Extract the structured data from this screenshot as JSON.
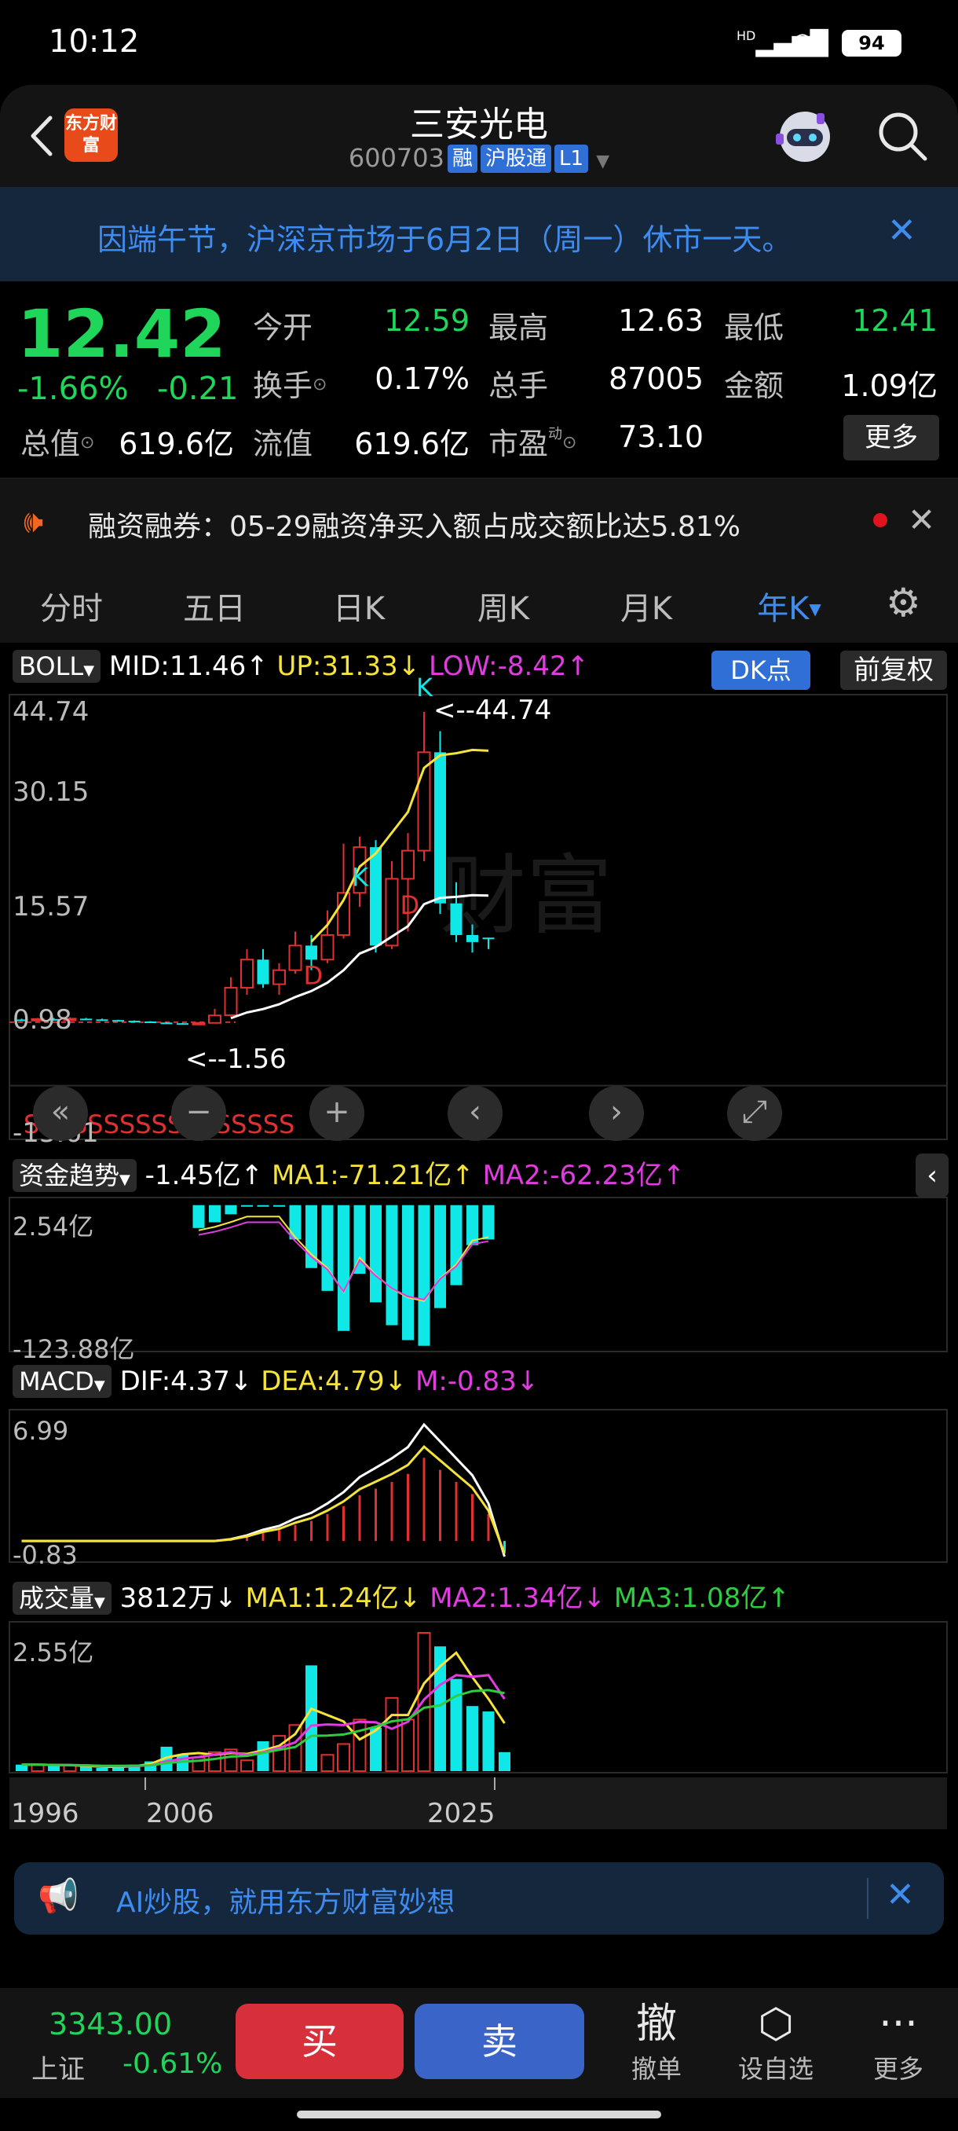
{
  "status_bar": {
    "time": "10:12",
    "signal_label": "HD",
    "battery": "94"
  },
  "header": {
    "logo_text": "东方财富",
    "stock_name": "三安光电",
    "stock_code": "600703",
    "tags": [
      "融",
      "沪股通",
      "L1"
    ]
  },
  "notice": {
    "text": "因端午节，沪深京市场于6月2日（周一）休市一天。"
  },
  "quote": {
    "price": "12.42",
    "change_pct": "-1.66%",
    "change_amt": "-0.21",
    "fields": [
      {
        "label": "今开",
        "value": "12.59",
        "color": "green"
      },
      {
        "label": "最高",
        "value": "12.63",
        "color": "white"
      },
      {
        "label": "最低",
        "value": "12.41",
        "color": "green"
      },
      {
        "label": "换手",
        "value": "0.17%",
        "color": "white"
      },
      {
        "label": "总手",
        "value": "87005",
        "color": "white"
      },
      {
        "label": "金额",
        "value": "1.09亿",
        "color": "white"
      },
      {
        "label": "总值",
        "value": "619.6亿",
        "color": "white"
      },
      {
        "label": "流值",
        "value": "619.6亿",
        "color": "white"
      },
      {
        "label": "市盈",
        "value": "73.10",
        "color": "white"
      }
    ],
    "pe_superscript": "动",
    "more_label": "更多"
  },
  "margin_banner": {
    "text": "融资融券：05-29融资净买入额占成交额比达5.81%"
  },
  "kline_tabs": {
    "items": [
      "分时",
      "五日",
      "日K",
      "周K",
      "月K",
      "年K"
    ],
    "active": "年K"
  },
  "indicators": {
    "boll": {
      "name": "BOLL",
      "mid": "MID:11.46",
      "up": "UP:31.33",
      "low": "LOW:-8.42"
    },
    "dk_label": "DK点",
    "fq_label": "前复权",
    "price_axis": [
      "44.74",
      "30.15",
      "15.57",
      "0.98",
      "-13.61"
    ],
    "high_marker": "<--44.74",
    "low_marker": "<--1.56",
    "fund": {
      "name": "资金趋势",
      "value": "-1.45亿",
      "ma1": "MA1:-71.21亿",
      "ma2": "MA2:-62.23亿",
      "axis_top": "2.54亿",
      "axis_bottom": "-123.88亿"
    },
    "macd": {
      "name": "MACD",
      "dif": "DIF:4.37",
      "dea": "DEA:4.79",
      "m": "M:-0.83",
      "axis_top": "6.99",
      "axis_bottom": "-0.83"
    },
    "volume": {
      "name": "成交量",
      "value": "3812万",
      "ma1": "MA1:1.24亿",
      "ma2": "MA2:1.34亿",
      "ma3": "MA3:1.08亿",
      "axis_top": "2.55亿"
    },
    "x_axis": [
      "1996",
      "2006",
      "2025"
    ]
  },
  "chart_data": {
    "type": "candlestick",
    "period": "年K",
    "price_range": [
      -13.61,
      44.74
    ],
    "candles": [
      {
        "o": 0.98,
        "c": 0.95,
        "h": 1.1,
        "l": 0.9,
        "dir": "down"
      },
      {
        "o": 0.96,
        "c": 1.05,
        "h": 1.2,
        "l": 0.9,
        "dir": "up"
      },
      {
        "o": 1.05,
        "c": 1.0,
        "h": 1.2,
        "l": 0.95,
        "dir": "down"
      },
      {
        "o": 1.0,
        "c": 1.1,
        "h": 1.3,
        "l": 0.95,
        "dir": "up"
      },
      {
        "o": 1.1,
        "c": 1.0,
        "h": 1.2,
        "l": 0.95,
        "dir": "down"
      },
      {
        "o": 1.0,
        "c": 0.9,
        "h": 1.1,
        "l": 0.85,
        "dir": "down"
      },
      {
        "o": 0.9,
        "c": 0.8,
        "h": 0.95,
        "l": 0.75,
        "dir": "down"
      },
      {
        "o": 0.8,
        "c": 0.7,
        "h": 0.85,
        "l": 0.6,
        "dir": "down"
      },
      {
        "o": 0.7,
        "c": 0.55,
        "h": 0.75,
        "l": 0.5,
        "dir": "down"
      },
      {
        "o": 0.55,
        "c": 0.45,
        "h": 0.6,
        "l": 0.4,
        "dir": "down"
      },
      {
        "o": 0.45,
        "c": 0.4,
        "h": 0.5,
        "l": 0.35,
        "dir": "down"
      },
      {
        "o": 0.4,
        "c": 0.5,
        "h": 0.55,
        "l": 0.35,
        "dir": "up"
      },
      {
        "o": 0.5,
        "c": 1.56,
        "h": 2.5,
        "l": 0.45,
        "dir": "up"
      },
      {
        "o": 1.6,
        "c": 5.5,
        "h": 7.0,
        "l": 1.4,
        "dir": "up"
      },
      {
        "o": 5.5,
        "c": 9.5,
        "h": 11.0,
        "l": 4.5,
        "dir": "up"
      },
      {
        "o": 9.5,
        "c": 6.0,
        "h": 11.0,
        "l": 5.5,
        "dir": "down"
      },
      {
        "o": 6.0,
        "c": 8.0,
        "h": 9.0,
        "l": 4.5,
        "dir": "up"
      },
      {
        "o": 8.0,
        "c": 11.5,
        "h": 13.5,
        "l": 7.5,
        "dir": "up"
      },
      {
        "o": 11.5,
        "c": 9.5,
        "h": 13.0,
        "l": 8.0,
        "dir": "down"
      },
      {
        "o": 9.5,
        "c": 13.0,
        "h": 16.5,
        "l": 9.0,
        "dir": "up"
      },
      {
        "o": 13.0,
        "c": 19.0,
        "h": 26.0,
        "l": 12.5,
        "dir": "up"
      },
      {
        "o": 19.0,
        "c": 25.5,
        "h": 27.0,
        "l": 17.0,
        "dir": "up"
      },
      {
        "o": 25.5,
        "c": 11.5,
        "h": 26.5,
        "l": 10.5,
        "dir": "down"
      },
      {
        "o": 11.5,
        "c": 21.0,
        "h": 23.5,
        "l": 11.0,
        "dir": "up"
      },
      {
        "o": 21.0,
        "c": 25.0,
        "h": 27.5,
        "l": 13.5,
        "dir": "up"
      },
      {
        "o": 25.0,
        "c": 39.0,
        "h": 44.74,
        "l": 23.5,
        "dir": "up"
      },
      {
        "o": 39.0,
        "c": 17.5,
        "h": 42.0,
        "l": 16.0,
        "dir": "down"
      },
      {
        "o": 17.5,
        "c": 13.0,
        "h": 20.5,
        "l": 12.0,
        "dir": "down"
      },
      {
        "o": 13.0,
        "c": 12.0,
        "h": 14.5,
        "l": 10.5,
        "dir": "down"
      },
      {
        "o": 12.63,
        "c": 12.42,
        "h": 12.63,
        "l": 11.0,
        "dir": "down"
      }
    ],
    "volume_range": [
      0,
      2.55
    ],
    "volume": [
      0.12,
      0.12,
      0.1,
      0.11,
      0.08,
      0.06,
      0.09,
      0.12,
      0.18,
      0.45,
      0.3,
      0.25,
      0.35,
      0.4,
      0.2,
      0.55,
      0.65,
      0.85,
      1.95,
      0.3,
      0.5,
      0.95,
      0.8,
      1.35,
      0.95,
      2.55,
      2.3,
      1.7,
      1.2,
      1.1,
      0.35
    ],
    "macd_range": [
      -0.83,
      6.99
    ],
    "macd_bars": [
      0,
      0,
      0,
      0,
      0,
      0,
      0,
      0,
      0,
      0,
      0,
      0,
      0,
      0.1,
      0.3,
      0.6,
      0.8,
      1.2,
      1.5,
      2.0,
      2.6,
      3.4,
      3.9,
      4.4,
      5.0,
      6.2,
      5.3,
      4.4,
      3.5,
      2.0,
      -0.83
    ],
    "fund_range": [
      -123.88,
      2.54
    ],
    "fund_bars": [
      -20,
      -15,
      -8,
      0,
      0,
      0,
      -30,
      -55,
      -75,
      -110,
      -60,
      -85,
      -105,
      -118,
      -123,
      -90,
      -70,
      -35,
      -30
    ]
  }
}
